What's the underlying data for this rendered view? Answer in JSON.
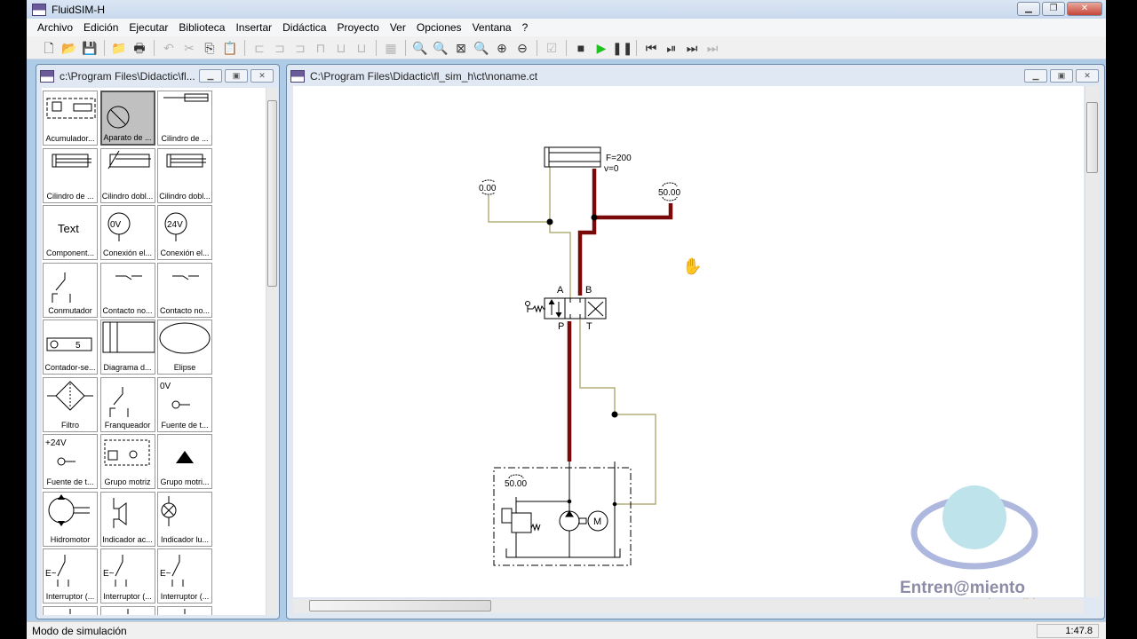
{
  "app": {
    "title": "FluidSIM-H"
  },
  "menu": [
    "Archivo",
    "Edición",
    "Ejecutar",
    "Biblioteca",
    "Insertar",
    "Didáctica",
    "Proyecto",
    "Ver",
    "Opciones",
    "Ventana",
    "?"
  ],
  "toolbar": [
    {
      "icon": "new-icon",
      "g": "🗋"
    },
    {
      "icon": "open-icon",
      "g": "📂"
    },
    {
      "icon": "save-icon",
      "g": "💾",
      "dis": true
    },
    {
      "sep": true
    },
    {
      "icon": "open-library-icon",
      "g": "📁"
    },
    {
      "icon": "print-icon",
      "g": "🖶"
    },
    {
      "sep": true
    },
    {
      "icon": "undo-icon",
      "g": "↶",
      "dis": true
    },
    {
      "icon": "cut-icon",
      "g": "✂",
      "dis": true
    },
    {
      "icon": "copy-icon",
      "g": "⎘"
    },
    {
      "icon": "paste-icon",
      "g": "📋",
      "dis": true
    },
    {
      "sep": true
    },
    {
      "icon": "align-left-icon",
      "g": "⊏",
      "dis": true
    },
    {
      "icon": "align-center-icon",
      "g": "⊐",
      "dis": true
    },
    {
      "icon": "align-right-icon",
      "g": "⊐",
      "dis": true
    },
    {
      "icon": "align-top-icon",
      "g": "⊓",
      "dis": true
    },
    {
      "icon": "align-middle-icon",
      "g": "⊔",
      "dis": true
    },
    {
      "icon": "align-bottom-icon",
      "g": "⊔",
      "dis": true
    },
    {
      "sep": true
    },
    {
      "icon": "grid-icon",
      "g": "▦",
      "dis": true
    },
    {
      "sep": true
    },
    {
      "icon": "zoom-100-icon",
      "g": "🔍",
      "dis": true
    },
    {
      "icon": "zoom-fit-icon",
      "g": "🔍",
      "dis": true
    },
    {
      "icon": "zoom-window-icon",
      "g": "⊠"
    },
    {
      "icon": "zoom-previous-icon",
      "g": "🔍"
    },
    {
      "icon": "zoom-in-icon",
      "g": "⊕"
    },
    {
      "icon": "zoom-out-icon",
      "g": "⊖"
    },
    {
      "sep": true
    },
    {
      "icon": "check-icon",
      "g": "☑",
      "dis": true
    },
    {
      "sep": true
    },
    {
      "icon": "stop-icon",
      "g": "■"
    },
    {
      "icon": "play-icon",
      "g": "▶",
      "play": true
    },
    {
      "icon": "pause-icon",
      "g": "❚❚"
    },
    {
      "sep": true
    },
    {
      "icon": "reset-icon",
      "g": "⏮"
    },
    {
      "icon": "step-icon",
      "g": "⏯"
    },
    {
      "icon": "step-forward-icon",
      "g": "⏭"
    },
    {
      "icon": "fast-forward-icon",
      "g": "⏭",
      "dis": true
    }
  ],
  "library_window": {
    "title": "c:\\Program Files\\Didactic\\fl...",
    "items": [
      {
        "label": "Acumulador...",
        "icon": "accumulator"
      },
      {
        "label": "Aparato de ...",
        "icon": "gauge",
        "selected": true
      },
      {
        "label": "Cilindro de ...",
        "icon": "cyl-rod"
      },
      {
        "label": "Cilindro de ...",
        "icon": "cyl"
      },
      {
        "label": "Cilindro dobl...",
        "icon": "cyl-adj"
      },
      {
        "label": "Cilindro dobl...",
        "icon": "cyl"
      },
      {
        "label": "Component...",
        "icon": "text",
        "text": "Text"
      },
      {
        "label": "Conexión el...",
        "icon": "circle-text",
        "text": "0V"
      },
      {
        "label": "Conexión el...",
        "icon": "circle-text",
        "text": "24V"
      },
      {
        "label": "Conmutador",
        "icon": "switch"
      },
      {
        "label": "Contacto no...",
        "icon": "contact"
      },
      {
        "label": "Contacto no...",
        "icon": "contact"
      },
      {
        "label": "Contador-se...",
        "icon": "counter",
        "text": "5"
      },
      {
        "label": "Diagrama d...",
        "icon": "diagram"
      },
      {
        "label": "Elipse",
        "icon": "ellipse"
      },
      {
        "label": "Filtro",
        "icon": "filter"
      },
      {
        "label": "Franqueador",
        "icon": "switch"
      },
      {
        "label": "Fuente de t...",
        "icon": "source",
        "text": "0V"
      },
      {
        "label": "Fuente de t...",
        "icon": "source",
        "text": "+24V"
      },
      {
        "label": "Grupo motriz",
        "icon": "power-unit"
      },
      {
        "label": "Grupo motri...",
        "icon": "triangle"
      },
      {
        "label": "Hidromotor",
        "icon": "motor"
      },
      {
        "label": "Indicador ac...",
        "icon": "buzzer"
      },
      {
        "label": "Indicador lu...",
        "icon": "lamp"
      },
      {
        "label": "Interruptor (...",
        "icon": "pushbutton"
      },
      {
        "label": "Interruptor (...",
        "icon": "pushbutton"
      },
      {
        "label": "Interruptor (...",
        "icon": "pushbutton"
      },
      {
        "label": "",
        "icon": "partial"
      },
      {
        "label": "",
        "icon": "partial"
      },
      {
        "label": "",
        "icon": "partial"
      }
    ]
  },
  "circuit_window": {
    "title": "C:\\Program Files\\Didactic\\fl_sim_h\\ct\\noname.ct"
  },
  "circuit": {
    "cylinder_force": "F=200",
    "cylinder_velocity": "v=0",
    "gauge_left": "0.00",
    "gauge_right": "50.00",
    "gauge_pump": "50.00",
    "port_a": "A",
    "port_b": "B",
    "port_p": "P",
    "port_t": "T",
    "pressurized_color": "#7a0a0a",
    "tank_line_color": "#b3ad7c"
  },
  "logo": {
    "line1": "Entren@miento",
    "line2": "a la medida"
  },
  "status": {
    "mode": "Modo de simulación",
    "time": "1:47.8"
  }
}
